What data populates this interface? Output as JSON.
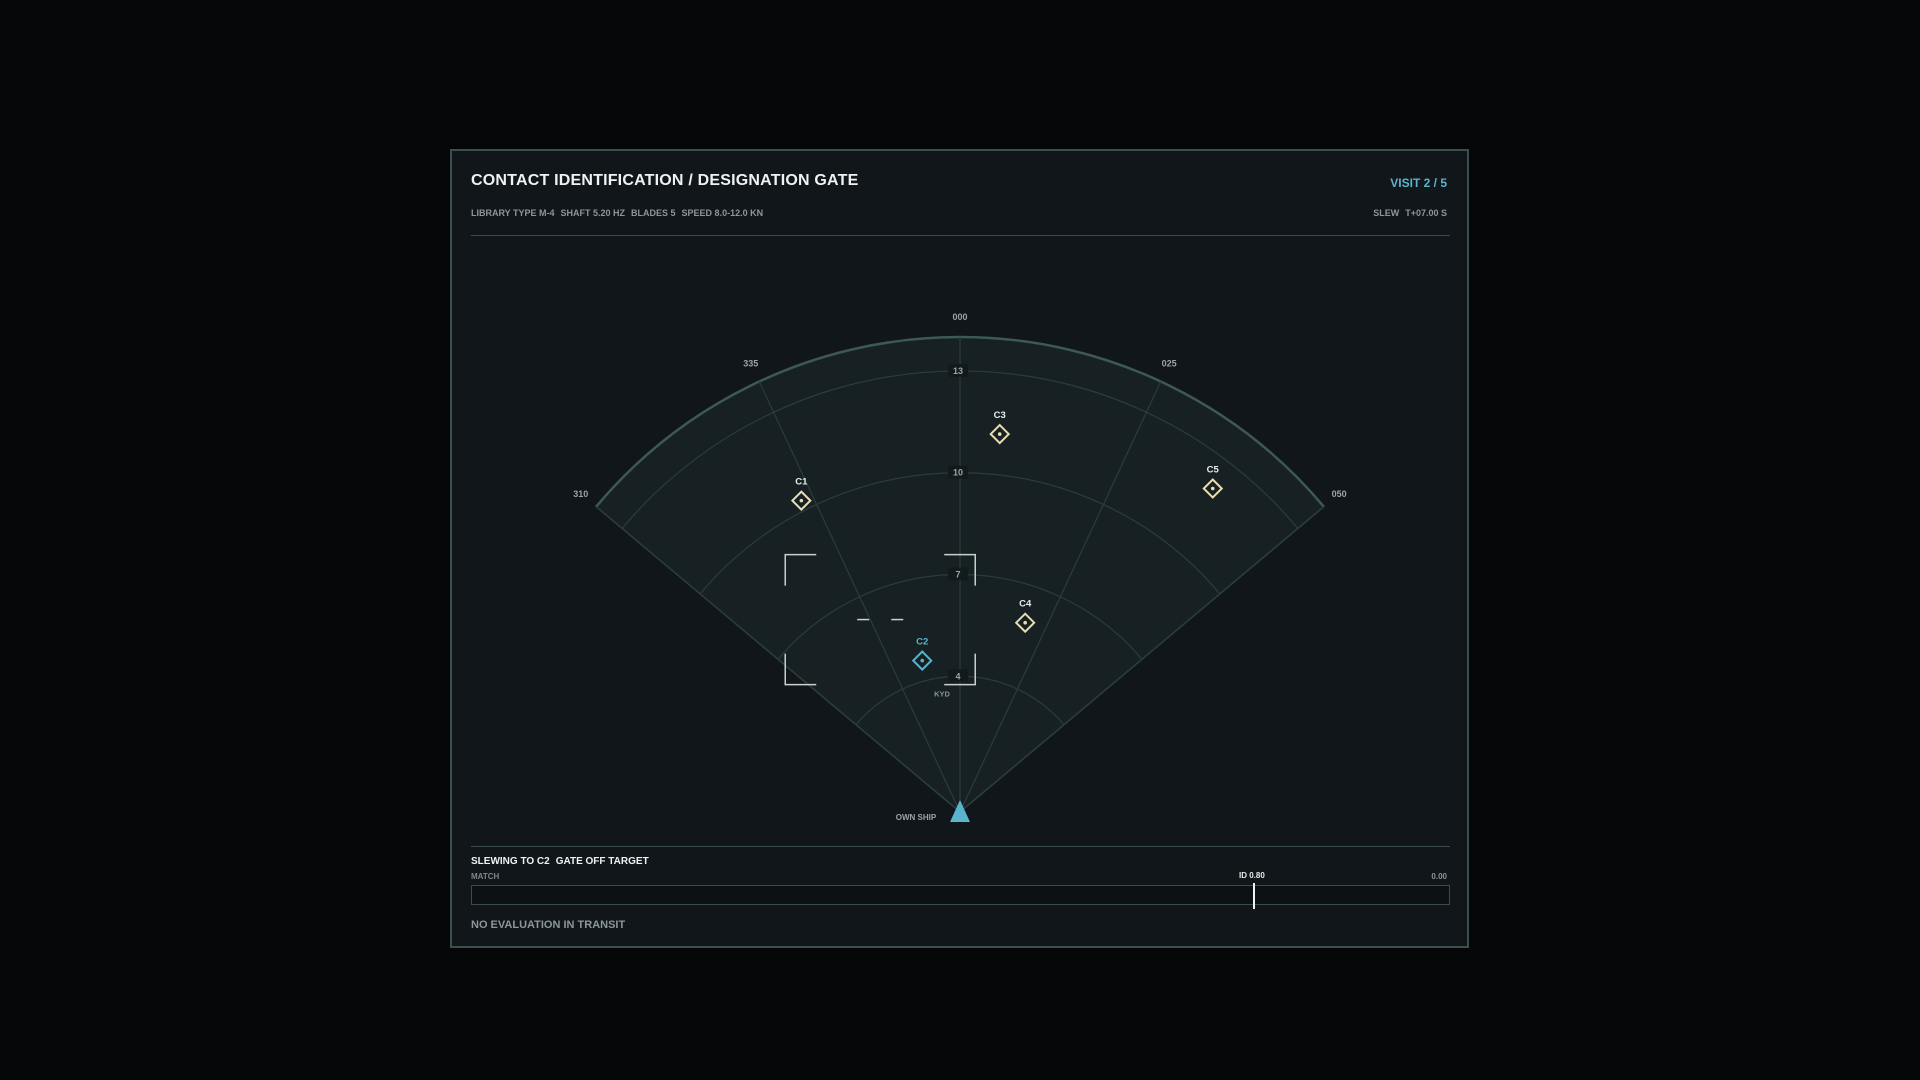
{
  "header": {
    "title": "CONTACT IDENTIFICATION / DESIGNATION GATE",
    "visit": "VISIT 2 / 5",
    "meta": [
      "LIBRARY TYPE M-4",
      "SHAFT 5.20 HZ",
      "BLADES 5",
      "SPEED 8.0-12.0 KN"
    ],
    "slew_label": "SLEW",
    "slew_value": "T+07.00 S"
  },
  "plot": {
    "bearings": [
      {
        "label": "310",
        "deg": -50
      },
      {
        "label": "335",
        "deg": -25
      },
      {
        "label": "000",
        "deg": 0
      },
      {
        "label": "025",
        "deg": 25
      },
      {
        "label": "050",
        "deg": 50
      }
    ],
    "range_max": 14,
    "ranges": [
      {
        "label": "4",
        "value": 4
      },
      {
        "label": "7",
        "value": 7
      },
      {
        "label": "10",
        "value": 10
      },
      {
        "label": "13",
        "value": 13
      }
    ],
    "range_unit": "KYD",
    "own_ship_label": "OWN SHIP",
    "contacts": [
      {
        "id": "C1",
        "bearing": 333,
        "range": 10.3,
        "selected": false
      },
      {
        "id": "C2",
        "bearing": 346,
        "range": 4.6,
        "selected": true
      },
      {
        "id": "C3",
        "bearing": 6,
        "range": 11.2,
        "selected": false
      },
      {
        "id": "C4",
        "bearing": 19,
        "range": 5.9,
        "selected": false
      },
      {
        "id": "C5",
        "bearing": 38,
        "range": 12.1,
        "selected": false
      }
    ],
    "gate_center_contact": "C2",
    "colors": {
      "accent": "#5ab4ce",
      "contact": "#e9dcae",
      "sector": "#172124",
      "grid": "#2b3c3c"
    }
  },
  "footer": {
    "status": [
      "SLEWING TO C2",
      "GATE OFF TARGET"
    ],
    "match_label": "MATCH",
    "id_label": "ID 0.80",
    "id_threshold": 0.8,
    "match_value": 0.0,
    "max_label": "0.00",
    "no_eval": "NO EVALUATION IN TRANSIT"
  }
}
